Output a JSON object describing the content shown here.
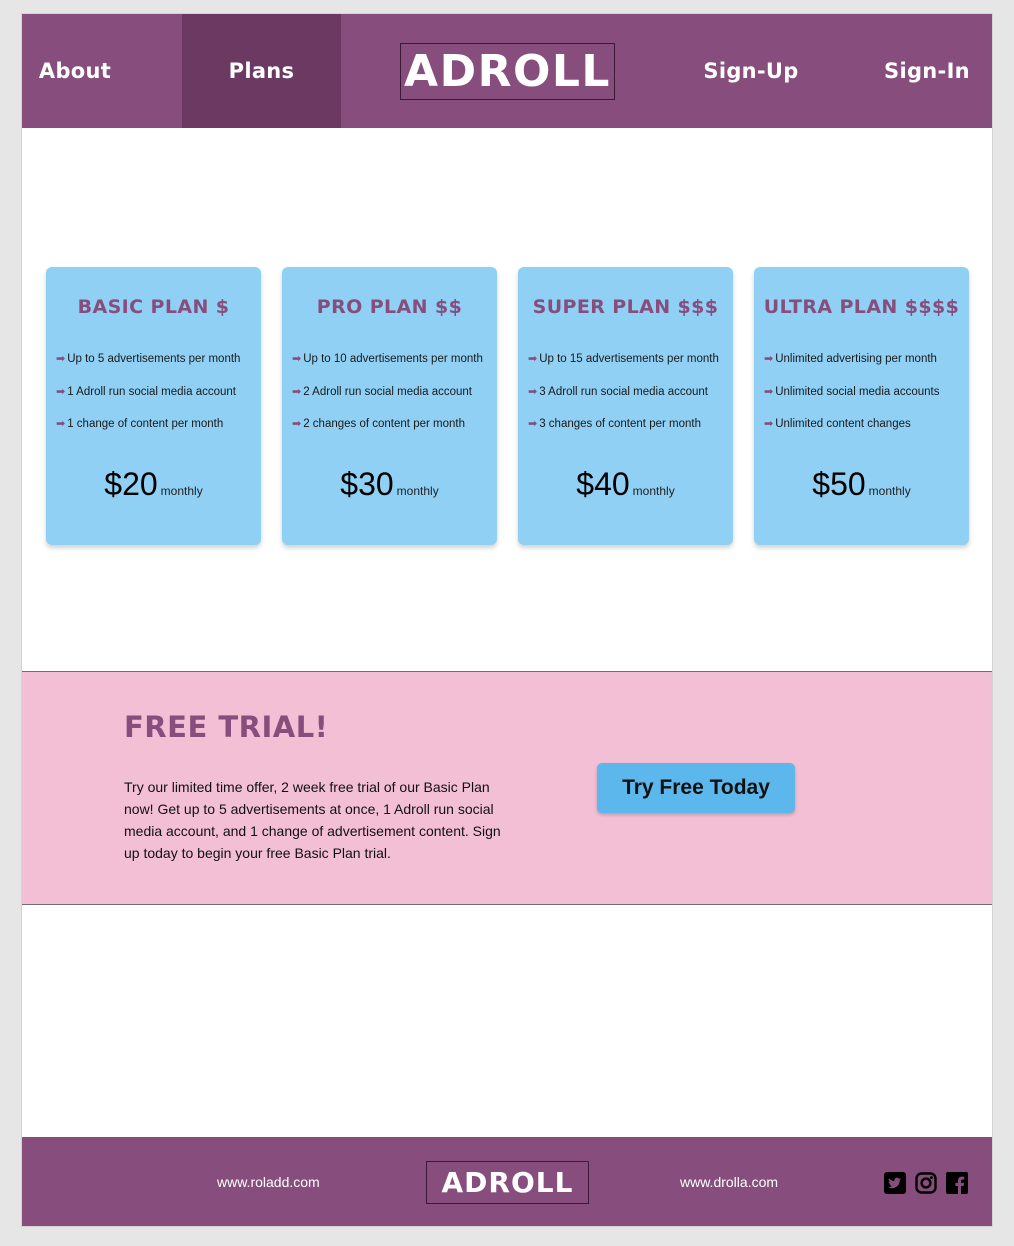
{
  "nav": {
    "about": "About",
    "plans": "Plans",
    "logo": "ADROLL",
    "signup": "Sign-Up",
    "signin": "Sign-In"
  },
  "plans": [
    {
      "title": "BASIC PLAN $",
      "features": [
        "Up to 5 advertisements per month",
        "1 Adroll run social media account",
        "1 change of content per month"
      ],
      "price": "$20",
      "period": "monthly"
    },
    {
      "title": "PRO PLAN $$",
      "features": [
        "Up to 10 advertisements per month",
        "2 Adroll run social media account",
        "2 changes of content per month"
      ],
      "price": "$30",
      "period": "monthly"
    },
    {
      "title": "SUPER PLAN $$$",
      "features": [
        "Up to 15 advertisements per month",
        "3 Adroll run social media account",
        "3 changes of content per month"
      ],
      "price": "$40",
      "period": "monthly"
    },
    {
      "title": "ULTRA PLAN $$$$",
      "features": [
        "Unlimited advertising per month",
        "Unlimited  social media accounts",
        "Unlimited content changes"
      ],
      "price": "$50",
      "period": "monthly"
    }
  ],
  "trial": {
    "title": "FREE TRIAL!",
    "text": "Try our limited time offer, 2 week free trial of our Basic Plan now! Get up to 5 advertisements at once, 1 Adroll run social media account, and 1 change of advertisement content. Sign up today to begin your free Basic Plan trial.",
    "button": "Try Free Today"
  },
  "footer": {
    "link1": "www.roladd.com",
    "logo": "ADROLL",
    "link2": "www.drolla.com",
    "icons": [
      "twitter-icon",
      "instagram-icon",
      "facebook-icon"
    ]
  },
  "colors": {
    "brand_purple": "#874e7d",
    "nav_active": "#6c3963",
    "card_blue": "#8fd0f4",
    "trial_pink": "#f3bfd5",
    "button_blue": "#5bb7ec"
  }
}
